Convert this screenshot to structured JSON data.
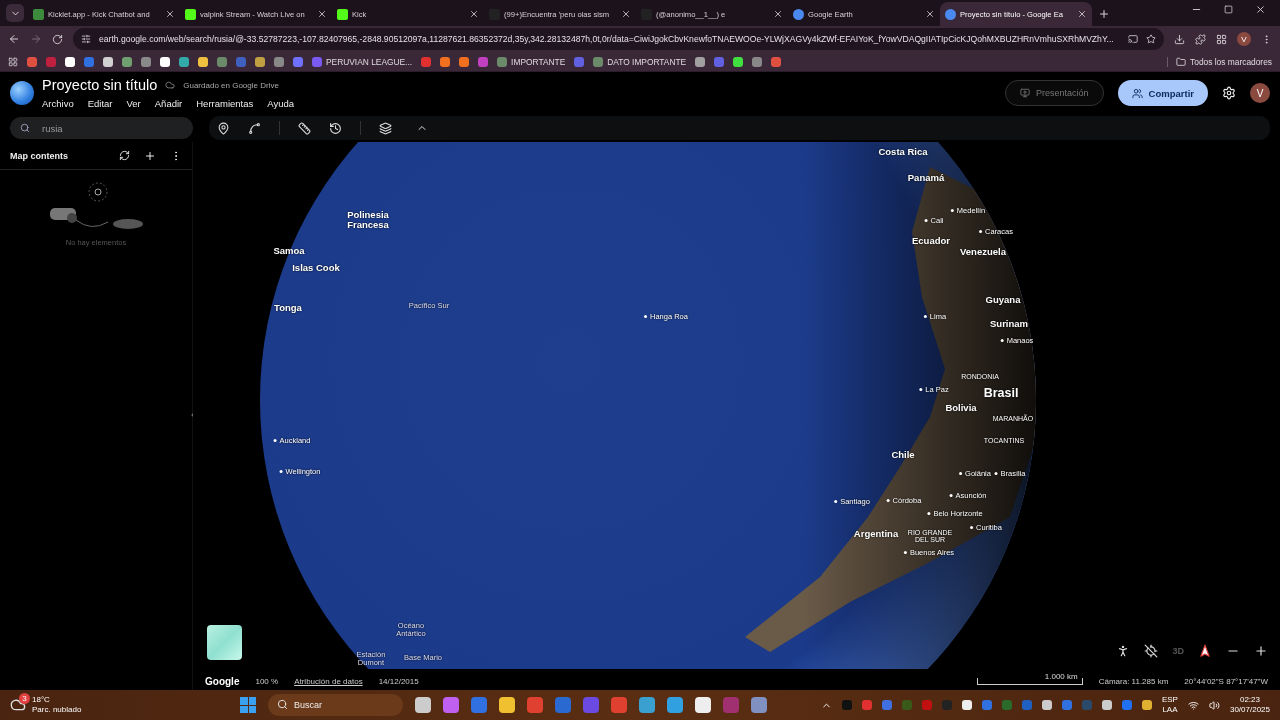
{
  "browser": {
    "tabs": [
      {
        "title": "Kicklet.app - Kick Chatbot and",
        "selected": false
      },
      {
        "title": "valpink Stream - Watch Live on",
        "selected": false
      },
      {
        "title": "Kick",
        "selected": false
      },
      {
        "title": "(99+)Encuentra 'peru olas sism",
        "selected": false
      },
      {
        "title": "(@anonimo__1__) e",
        "selected": false
      },
      {
        "title": "Google Earth",
        "selected": false
      },
      {
        "title": "Proyecto sin título - Google Ea",
        "selected": true
      }
    ],
    "url": "earth.google.com/web/search/rusia/@-33.52787223,-107.82407965,-2848.90512097a,11287621.86352372d,35y,342.28132487h,0t,0r/data=CiwiJgokCbvKnewfoTNAEWOOe-YLWjXAGVy4kZWf-EFAIYoK_fYowVDAQgIIATIpCicKJQohMXBUZHRnVmhuSXRhMVZhY...",
    "bookmarks": [
      {
        "kind": "icon"
      },
      {
        "kind": "icon"
      },
      {
        "kind": "icon"
      },
      {
        "kind": "icon"
      },
      {
        "kind": "icon"
      },
      {
        "kind": "icon"
      },
      {
        "kind": "icon"
      },
      {
        "kind": "icon"
      },
      {
        "kind": "icon"
      },
      {
        "kind": "icon"
      },
      {
        "kind": "icon"
      },
      {
        "kind": "icon"
      },
      {
        "kind": "icon"
      },
      {
        "kind": "icon"
      },
      {
        "kind": "icon"
      },
      {
        "kind": "folder",
        "label": "PERUVIAN LEAGUE..."
      },
      {
        "kind": "icon"
      },
      {
        "kind": "icon"
      },
      {
        "kind": "icon"
      },
      {
        "kind": "icon"
      },
      {
        "kind": "link",
        "label": "IMPORTANTE"
      },
      {
        "kind": "icon"
      },
      {
        "kind": "link",
        "label": "DATO IMPORTANTE"
      },
      {
        "kind": "icon"
      },
      {
        "kind": "icon"
      },
      {
        "kind": "icon"
      },
      {
        "kind": "icon"
      },
      {
        "kind": "icon"
      }
    ],
    "all_bookmarks": "Todos los marcadores",
    "profile_initial": "V"
  },
  "app": {
    "title": "Proyecto sin título",
    "save_status": "Guardado en Google Drive",
    "menu": [
      "Archivo",
      "Editar",
      "Ver",
      "Añadir",
      "Herramientas",
      "Ayuda"
    ],
    "presentation": "Presentación",
    "share": "Compartir",
    "avatar": "V",
    "search": {
      "value": "rusia"
    }
  },
  "sidebar": {
    "title": "Map contents",
    "empty_text": "No hay elementos"
  },
  "map": {
    "labels": [
      {
        "text": "Costa Rica",
        "kind": "country"
      },
      {
        "text": "Panamá",
        "kind": "country"
      },
      {
        "text": "Medellín",
        "kind": "city"
      },
      {
        "text": "Cali",
        "kind": "city"
      },
      {
        "text": "Caracas",
        "kind": "city"
      },
      {
        "text": "Ecuador",
        "kind": "country"
      },
      {
        "text": "Venezuela",
        "kind": "country"
      },
      {
        "text": "Polinesia Francesa",
        "kind": "country"
      },
      {
        "text": "Samoa",
        "kind": "country"
      },
      {
        "text": "Islas Cook",
        "kind": "country"
      },
      {
        "text": "Tonga",
        "kind": "country"
      },
      {
        "text": "Pacífico Sur",
        "kind": "ocean"
      },
      {
        "text": "Hanga Roa",
        "kind": "city"
      },
      {
        "text": "Lima",
        "kind": "city"
      },
      {
        "text": "Guyana",
        "kind": "country"
      },
      {
        "text": "Surinam",
        "kind": "country"
      },
      {
        "text": "Manaos",
        "kind": "city"
      },
      {
        "text": "RONDONIA",
        "kind": "region"
      },
      {
        "text": "La Paz",
        "kind": "city"
      },
      {
        "text": "Brasil",
        "kind": "large"
      },
      {
        "text": "Bolivia",
        "kind": "country"
      },
      {
        "text": "MARANHÃO",
        "kind": "region"
      },
      {
        "text": "TOCANTINS",
        "kind": "region"
      },
      {
        "text": "Auckland",
        "kind": "city"
      },
      {
        "text": "Wellington",
        "kind": "city"
      },
      {
        "text": "Chile",
        "kind": "country"
      },
      {
        "text": "Goiânia",
        "kind": "city"
      },
      {
        "text": "Brasília",
        "kind": "city"
      },
      {
        "text": "Asunción",
        "kind": "city"
      },
      {
        "text": "Santiago",
        "kind": "city"
      },
      {
        "text": "Córdoba",
        "kind": "city"
      },
      {
        "text": "Belo Horizonte",
        "kind": "city"
      },
      {
        "text": "Argentina",
        "kind": "country"
      },
      {
        "text": "RIO GRANDE DEL SUR",
        "kind": "region"
      },
      {
        "text": "Curitiba",
        "kind": "city"
      },
      {
        "text": "Buenos Aires",
        "kind": "city"
      },
      {
        "text": "Océano Antártico",
        "kind": "ocean"
      },
      {
        "text": "Estación Dumont",
        "kind": "ocean"
      },
      {
        "text": "Base Mario",
        "kind": "ocean"
      }
    ],
    "mode_3d": "3D",
    "footer": {
      "logo": "Google",
      "zoom": "100 %",
      "attribution": "Atribución de datos",
      "date": "14/12/2015",
      "scale": "1.000 km",
      "camera": "Cámara: 11.285 km",
      "coordinates": "20°44'02\"S 87°17'47\"W"
    }
  },
  "taskbar": {
    "weather": {
      "badge": "3",
      "temp": "18°C",
      "desc": "Parc. nublado"
    },
    "search_placeholder": "Buscar",
    "lang": "ESP",
    "layout": "LAA",
    "time": "02:23",
    "date": "30/07/2025"
  }
}
